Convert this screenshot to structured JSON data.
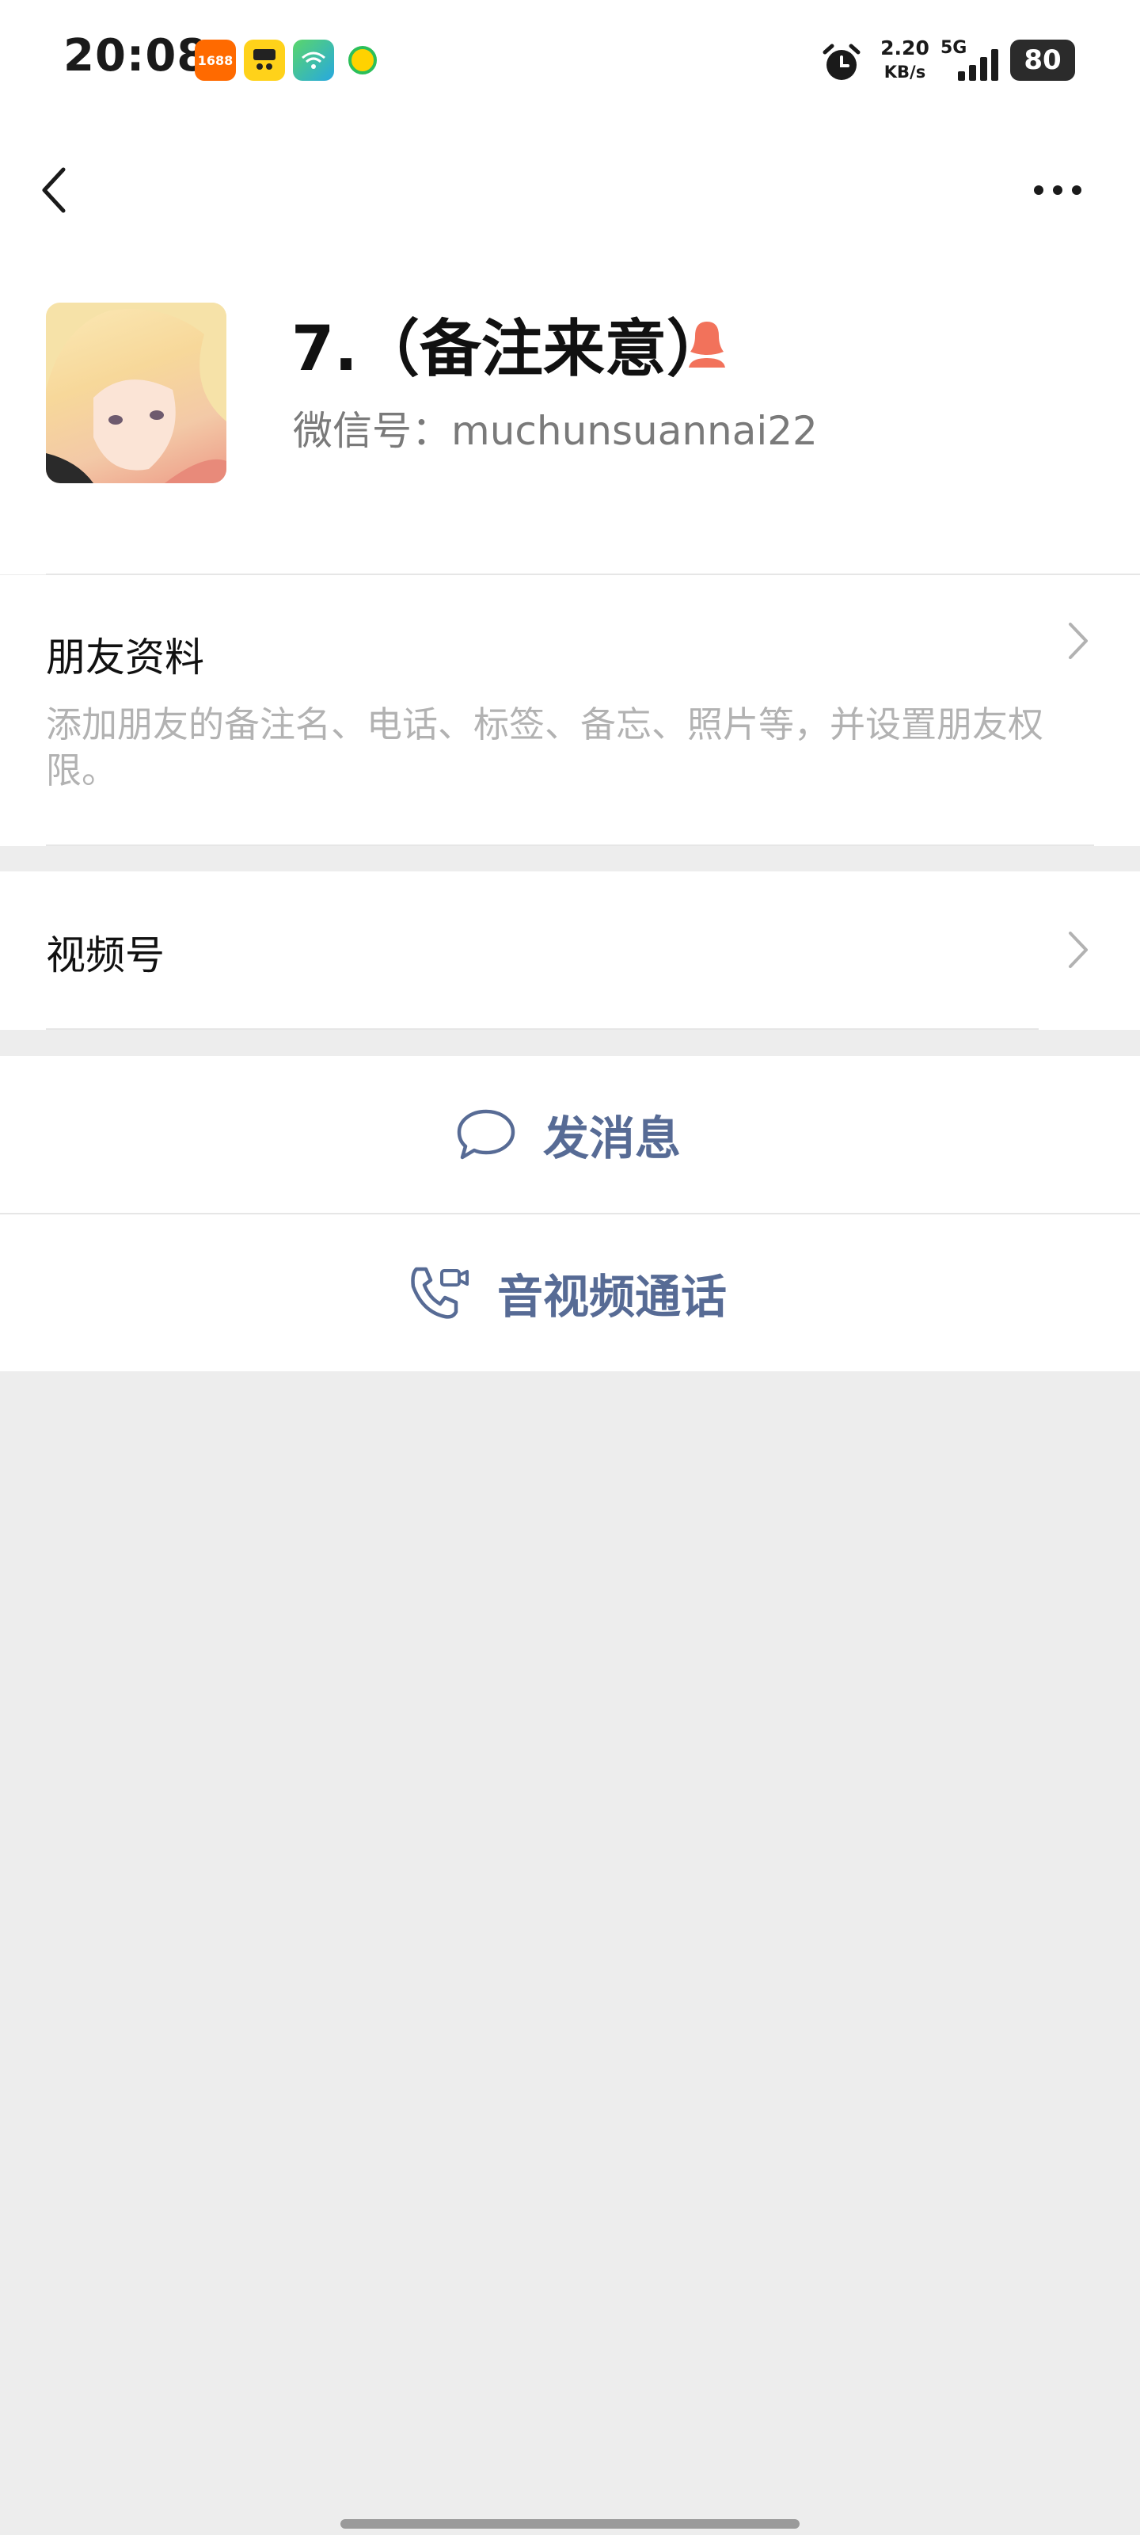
{
  "status_bar": {
    "time": "20:08",
    "apps": [
      "1688-app-icon",
      "yellow-app-icon",
      "wifi-app-icon",
      "music-app-icon"
    ],
    "app_1688_label": "1688",
    "net_speed_value": "2.20",
    "net_speed_unit": "KB/s",
    "network": "5G",
    "battery": "80"
  },
  "nav": {
    "back_icon": "chevron-left-icon",
    "more_icon": "more-dots-icon"
  },
  "profile": {
    "name": "7.（备注来意）",
    "gender_icon": "female-icon",
    "gender_color": "#f2725b",
    "wechat_id": "微信号：muchunsuannai22"
  },
  "friend_info": {
    "title": "朋友资料",
    "description": "添加朋友的备注名、电话、标签、备忘、照片等，并设置朋友权限。"
  },
  "channels": {
    "title": "视频号"
  },
  "actions": {
    "send_message": "发消息",
    "av_call": "音视频通话",
    "accent_color": "#576b95"
  }
}
